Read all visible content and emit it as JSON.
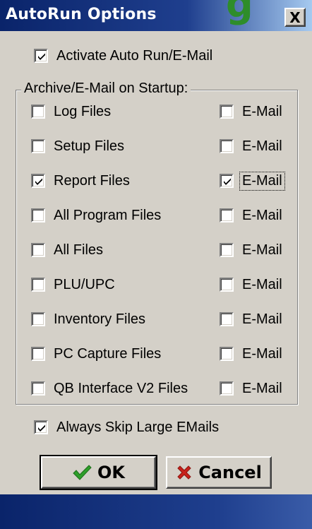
{
  "window": {
    "title": "AutoRun Options",
    "close_label": "X",
    "title_bg_glyph": "g"
  },
  "activate": {
    "label": "Activate Auto Run/E-Mail",
    "checked": true
  },
  "group": {
    "legend": "Archive/E-Mail on Startup:",
    "rows": [
      {
        "label": "Log Files",
        "checked": false,
        "email_label": "E-Mail",
        "email_checked": false
      },
      {
        "label": "Setup Files",
        "checked": false,
        "email_label": "E-Mail",
        "email_checked": false
      },
      {
        "label": "Report Files",
        "checked": true,
        "email_label": "E-Mail",
        "email_checked": true
      },
      {
        "label": "All Program Files",
        "checked": false,
        "email_label": "E-Mail",
        "email_checked": false
      },
      {
        "label": "All Files",
        "checked": false,
        "email_label": "E-Mail",
        "email_checked": false
      },
      {
        "label": "PLU/UPC",
        "checked": false,
        "email_label": "E-Mail",
        "email_checked": false
      },
      {
        "label": "Inventory Files",
        "checked": false,
        "email_label": "E-Mail",
        "email_checked": false
      },
      {
        "label": "PC Capture Files",
        "checked": false,
        "email_label": "E-Mail",
        "email_checked": false
      },
      {
        "label": "QB Interface V2 Files",
        "checked": false,
        "email_label": "E-Mail",
        "email_checked": false
      }
    ]
  },
  "skip_large": {
    "label": "Always Skip Large EMails",
    "checked": true
  },
  "buttons": {
    "ok_label": "OK",
    "ok_icon": "checkmark-icon",
    "cancel_label": "Cancel",
    "cancel_icon": "x-icon"
  },
  "colors": {
    "title_bar": "#0a246a",
    "dialog_face": "#d4d0c8",
    "ok_check": "#2e9e2a",
    "cancel_x": "#c8221c"
  }
}
